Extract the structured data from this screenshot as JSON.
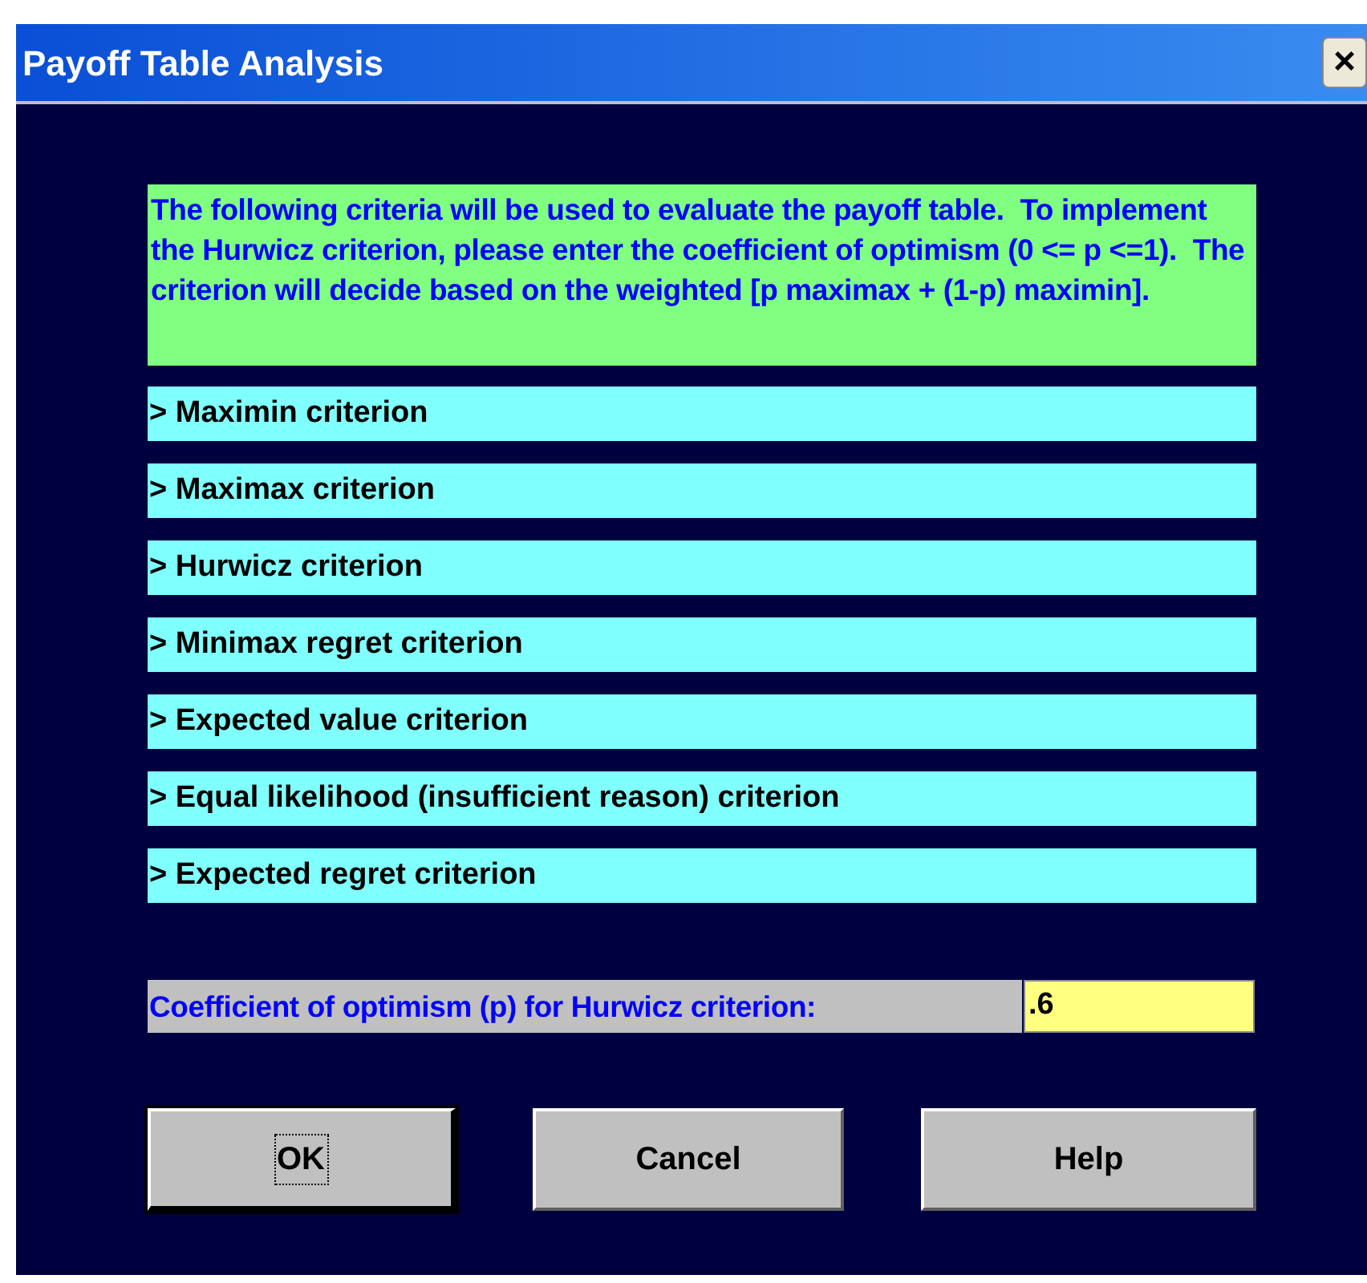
{
  "window": {
    "title": "Payoff Table Analysis",
    "close": "×"
  },
  "intro": "The following criteria will be used to evaluate the payoff table.  To implement the Hurwicz criterion, please enter the coefficient of optimism (0 <= p <=1).  The criterion will decide based on the weighted [p maximax + (1-p) maximin].",
  "criteria": [
    "> Maximin criterion",
    "> Maximax criterion",
    "> Hurwicz criterion",
    "> Minimax regret criterion",
    "> Expected value criterion",
    "> Equal likelihood (insufficient reason) criterion",
    "> Expected regret criterion"
  ],
  "coefficient": {
    "label": "Coefficient of optimism (p) for Hurwicz criterion:",
    "value": ".6"
  },
  "buttons": [
    {
      "label": "OK",
      "focused": true
    },
    {
      "label": "Cancel",
      "focused": false
    },
    {
      "label": "Help",
      "focused": false
    }
  ]
}
